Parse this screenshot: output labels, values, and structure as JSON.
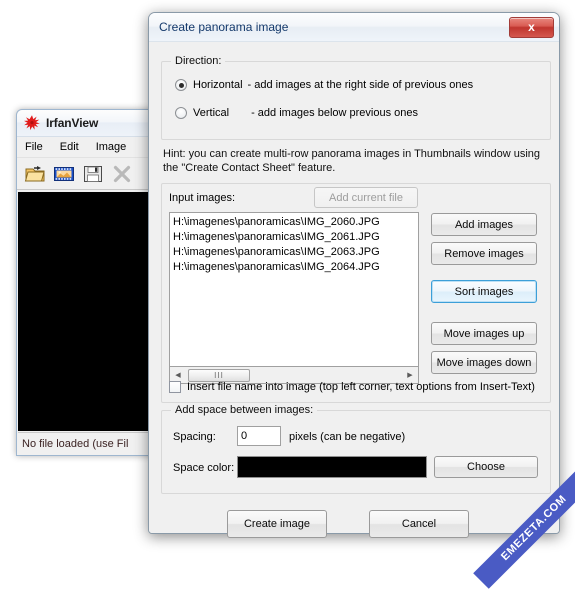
{
  "irfanview": {
    "title": "IrfanView",
    "logo_icon": "irfanview-starburst-icon",
    "menus": [
      "File",
      "Edit",
      "Image"
    ],
    "toolbar": [
      {
        "icon": "open-folder-icon",
        "label": "Open"
      },
      {
        "icon": "thumbnails-filmstrip-icon",
        "label": "Thumbnails"
      },
      {
        "icon": "save-floppy-icon",
        "label": "Save"
      },
      {
        "icon": "delete-x-icon",
        "label": "Delete"
      }
    ],
    "status_text": "No file loaded (use Fil"
  },
  "dialog": {
    "title": "Create panorama image",
    "close_label": "x",
    "direction": {
      "group_label": "Direction:",
      "options": [
        {
          "label": "Horizontal",
          "description": "- add images at the right side of previous ones",
          "checked": true
        },
        {
          "label": "Vertical",
          "description": "- add images below previous ones",
          "checked": false
        }
      ]
    },
    "hint": {
      "line1": "Hint: you can create multi-row panorama images in Thumbnails window using",
      "line2": "the \"Create Contact Sheet\" feature."
    },
    "input_images": {
      "label": "Input images:",
      "add_current_file_label": "Add current file",
      "add_current_file_disabled": true,
      "files": [
        "H:\\imagenes\\panoramicas\\IMG_2060.JPG",
        "H:\\imagenes\\panoramicas\\IMG_2061.JPG",
        "H:\\imagenes\\panoramicas\\IMG_2063.JPG",
        "H:\\imagenes\\panoramicas\\IMG_2064.JPG"
      ],
      "scrollbar": {
        "left_arrow": "◀",
        "right_arrow": "▶",
        "thumb_grip": "III"
      },
      "side_buttons": [
        {
          "label": "Add images",
          "focused": false
        },
        {
          "label": "Remove images",
          "focused": false
        },
        {
          "label": "Sort images",
          "focused": true
        },
        {
          "label": "Move images up",
          "focused": false
        },
        {
          "label": "Move images down",
          "focused": false
        }
      ]
    },
    "insert_filename": {
      "label": "Insert file name into image (top left corner, text options from Insert-Text)",
      "checked": false
    },
    "spacing_group": {
      "group_label": "Add space between images:",
      "spacing_label": "Spacing:",
      "spacing_value": "0",
      "spacing_units": "pixels (can be negative)",
      "space_color_label": "Space color:",
      "space_color_value": "#000000",
      "choose_label": "Choose"
    },
    "footer": {
      "create_label": "Create image",
      "cancel_label": "Cancel"
    }
  },
  "watermark": {
    "text": "EMEZETA.COM",
    "color": "#4a5bc4"
  }
}
